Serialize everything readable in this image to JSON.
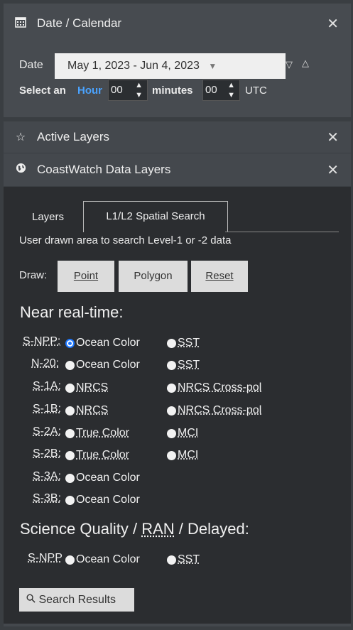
{
  "date_section": {
    "title": "Date / Calendar",
    "date_label": "Date",
    "date_range": "May 1, 2023 - Jun 4, 2023",
    "select_label": "Select an",
    "hour_word": "Hour",
    "hour_value": "00",
    "minutes_label": "minutes",
    "minutes_value": "00",
    "tz": "UTC"
  },
  "active_layers": {
    "title": "Active Layers"
  },
  "coastwatch": {
    "title": "CoastWatch Data Layers"
  },
  "tabs": [
    {
      "label": "Layers"
    },
    {
      "label": "L1/L2 Spatial Search"
    }
  ],
  "description": "User drawn area to search Level-1 or -2 data",
  "draw": {
    "label": "Draw:",
    "point": "Point",
    "polygon": "Polygon",
    "reset": "Reset"
  },
  "nrt": {
    "heading": "Near real-time:",
    "rows": [
      {
        "sat": "S-NPP:",
        "opt1": "Ocean Color",
        "opt2": "SST"
      },
      {
        "sat": "N-20:",
        "opt1": "Ocean Color",
        "opt2": "SST"
      },
      {
        "sat": "S-1A:",
        "opt1": "NRCS",
        "opt2": "NRCS Cross-pol"
      },
      {
        "sat": "S-1B:",
        "opt1": "NRCS",
        "opt2": "NRCS Cross-pol"
      },
      {
        "sat": "S-2A:",
        "opt1": "True Color",
        "opt2": "MCI"
      },
      {
        "sat": "S-2B:",
        "opt1": "True Color",
        "opt2": "MCI"
      },
      {
        "sat": "S-3A:",
        "opt1": "Ocean Color"
      },
      {
        "sat": "S-3B:",
        "opt1": "Ocean Color"
      }
    ]
  },
  "science": {
    "heading_a": "Science Quality / ",
    "heading_ran": "RAN",
    "heading_b": " / Delayed:",
    "sat": "S-NPP",
    "opt1": "Ocean Color",
    "opt2": "SST"
  },
  "search_button": "Search Results",
  "icons": {
    "calendar": "calendar-icon",
    "star": "star-icon",
    "globe": "globe-icon",
    "close": "close-icon",
    "search": "search-icon"
  }
}
